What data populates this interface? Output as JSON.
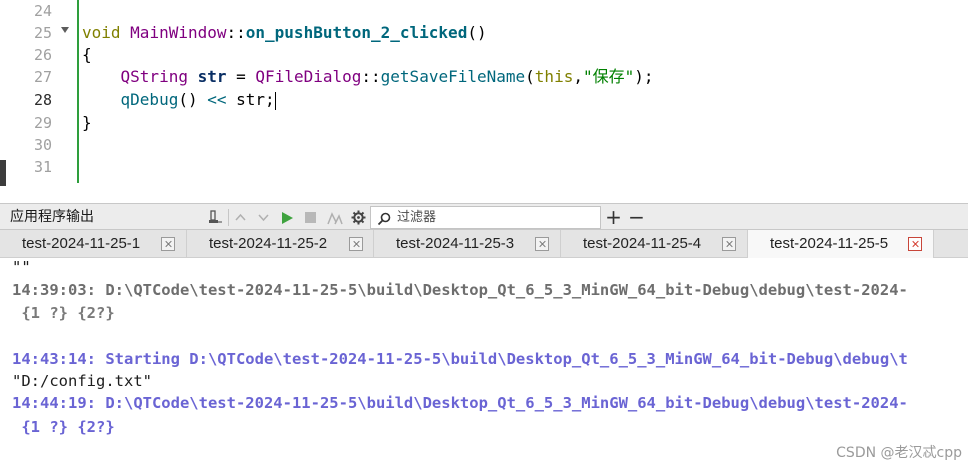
{
  "editor": {
    "line_numbers": [
      "24",
      "25",
      "26",
      "27",
      "28",
      "29",
      "30",
      "31"
    ],
    "code": {
      "l25_kw": "void",
      "l25_class": "MainWindow",
      "l25_sep": "::",
      "l25_fn": "on_pushButton_2_clicked",
      "l25_parens": "()",
      "l26": "{",
      "l27_indent": "    ",
      "l27_type": "QString",
      "l27_var": "str",
      "l27_eq": " = ",
      "l27_class": "QFileDialog",
      "l27_sep": "::",
      "l27_fn": "getSaveFileName",
      "l27_open": "(",
      "l27_this": "this",
      "l27_comma": ",",
      "l27_str": "\"保存\"",
      "l27_close": ");",
      "l28_indent": "    ",
      "l28_fn": "qDebug",
      "l28_rest1": "() ",
      "l28_op": "<<",
      "l28_rest2": " str;",
      "l29": "}"
    }
  },
  "output_pane": {
    "title": "应用程序输出",
    "filter_placeholder": "过滤器",
    "toolbar_icons": [
      "attach-icon",
      "up-arrow-icon",
      "down-arrow-icon",
      "run-icon",
      "stop-icon",
      "settings-icon",
      "gear-icon",
      "search-icon",
      "plus-icon",
      "minus-icon"
    ],
    "plus_glyph": "+",
    "minus_glyph": "−",
    "tabs": [
      {
        "label": "test-2024-11-25-1",
        "active": false
      },
      {
        "label": "test-2024-11-25-2",
        "active": false
      },
      {
        "label": "test-2024-11-25-3",
        "active": false
      },
      {
        "label": "test-2024-11-25-4",
        "active": false
      },
      {
        "label": "test-2024-11-25-5",
        "active": true
      }
    ],
    "lines": [
      "\"\"",
      "14:39:03: D:\\QTCode\\test-2024-11-25-5\\build\\Desktop_Qt_6_5_3_MinGW_64_bit-Debug\\debug\\test-2024-",
      " {1 ?} {2?}",
      "",
      "14:43:14: Starting D:\\QTCode\\test-2024-11-25-5\\build\\Desktop_Qt_6_5_3_MinGW_64_bit-Debug\\debug\\t",
      "\"D:/config.txt\"",
      "14:44:19: D:\\QTCode\\test-2024-11-25-5\\build\\Desktop_Qt_6_5_3_MinGW_64_bit-Debug\\debug\\test-2024-",
      " {1 ?} {2?}"
    ]
  },
  "watermark": "CSDN @老汉忒cpp",
  "colors": {
    "change_bar": "#2e9e3c",
    "run_green": "#3fa33f",
    "output_blue": "#6a64d4",
    "close_red": "#d4382c"
  }
}
